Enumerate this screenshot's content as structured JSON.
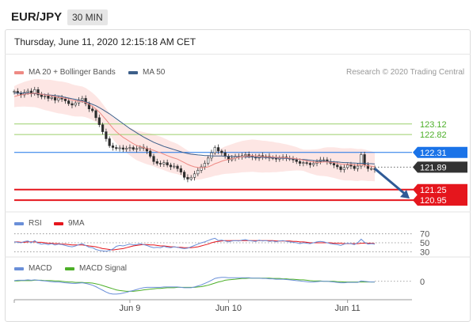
{
  "header": {
    "pair": "EUR/JPY",
    "timeframe": "30 MIN"
  },
  "datetime": "Thursday, June 11, 2020 12:15:18 AM CET",
  "credit": "Research © 2020 Trading Central",
  "legends": {
    "ma20": "MA 20 + Bollinger Bands",
    "ma50": "MA 50",
    "rsi": "RSI",
    "rsi9": "9MA",
    "macd": "MACD",
    "macd_signal": "MACD Signal"
  },
  "colors": {
    "ma20": "#ee8a84",
    "ma50": "#3d5f8a",
    "band": "#fde3e1",
    "pivot": "#1a73e8",
    "resistance": "#9ccf6b",
    "support": "#e5161d",
    "last": "#333333",
    "rsi": "#6a8fd8",
    "rsi9": "#e5161d",
    "macd": "#6a8fd8",
    "macd_signal": "#4caf28"
  },
  "chart_data": [
    {
      "type": "candlestick",
      "x_ticks": [
        "Jun 9",
        "Jun 10",
        "Jun 11"
      ],
      "price_labels": [
        {
          "label": "123.12",
          "value": 123.12,
          "kind": "resistance"
        },
        {
          "label": "122.82",
          "value": 122.82,
          "kind": "resistance"
        },
        {
          "label": "122.31",
          "value": 122.31,
          "kind": "pivot"
        },
        {
          "label": "121.89",
          "value": 121.89,
          "kind": "last"
        },
        {
          "label": "121.25",
          "value": 121.25,
          "kind": "support"
        },
        {
          "label": "120.95",
          "value": 120.95,
          "kind": "support"
        }
      ],
      "ylim": [
        120.75,
        124.4
      ],
      "close": [
        124.05,
        124.0,
        123.95,
        124.02,
        124.06,
        123.98,
        124.1,
        123.95,
        123.9,
        123.92,
        123.85,
        123.88,
        123.8,
        123.86,
        123.83,
        123.78,
        123.7,
        123.66,
        123.72,
        123.8,
        123.85,
        123.7,
        123.55,
        123.5,
        123.3,
        123.1,
        122.9,
        122.7,
        122.5,
        122.45,
        122.42,
        122.44,
        122.4,
        122.43,
        122.45,
        122.4,
        122.42,
        122.46,
        122.43,
        122.35,
        122.2,
        122.05,
        122.0,
        121.98,
        122.02,
        121.95,
        121.9,
        121.92,
        121.85,
        121.75,
        121.6,
        121.55,
        121.6,
        121.7,
        121.8,
        121.9,
        122.0,
        122.15,
        122.3,
        122.45,
        122.35,
        122.3,
        122.2,
        122.1,
        122.15,
        122.2,
        122.18,
        122.22,
        122.25,
        122.2,
        122.18,
        122.15,
        122.22,
        122.18,
        122.2,
        122.15,
        122.16,
        122.12,
        122.15,
        122.18,
        122.15,
        122.12,
        122.1,
        122.05,
        122.0,
        122.02,
        122.0,
        121.96,
        122.0,
        122.05,
        122.1,
        122.1,
        122.05,
        122.0,
        121.95,
        121.9,
        121.82,
        121.88,
        121.95,
        121.92,
        121.85,
        121.92,
        122.25,
        121.95,
        121.85,
        121.85,
        121.82
      ],
      "ma20": [
        123.9,
        123.93,
        123.95,
        123.97,
        123.98,
        123.99,
        124.0,
        123.99,
        123.97,
        123.95,
        123.94,
        123.92,
        123.9,
        123.88,
        123.87,
        123.85,
        123.83,
        123.8,
        123.78,
        123.77,
        123.76,
        123.73,
        123.68,
        123.62,
        123.55,
        123.46,
        123.35,
        123.24,
        123.12,
        123.0,
        122.9,
        122.82,
        122.74,
        122.68,
        122.62,
        122.56,
        122.51,
        122.48,
        122.45,
        122.42,
        122.4,
        122.37,
        122.33,
        122.3,
        122.26,
        122.22,
        122.18,
        122.15,
        122.12,
        122.07,
        122.02,
        121.97,
        121.93,
        121.9,
        121.88,
        121.87,
        121.88,
        121.9,
        121.94,
        121.99,
        122.02,
        122.06,
        122.09,
        122.11,
        122.13,
        122.15,
        122.17,
        122.19,
        122.2,
        122.21,
        122.22,
        122.21,
        122.2,
        122.19,
        122.19,
        122.18,
        122.18,
        122.17,
        122.17,
        122.16,
        122.16,
        122.15,
        122.14,
        122.13,
        122.11,
        122.09,
        122.07,
        122.05,
        122.04,
        122.03,
        122.03,
        122.04,
        122.04,
        122.03,
        122.02,
        122.0,
        121.98,
        121.97,
        121.97,
        121.97,
        121.96,
        121.95,
        121.96,
        121.95,
        121.93,
        121.92,
        121.9
      ],
      "ma50": [
        124.0,
        124.0,
        124.0,
        124.0,
        124.0,
        123.99,
        123.99,
        123.98,
        123.97,
        123.96,
        123.95,
        123.94,
        123.93,
        123.92,
        123.9,
        123.88,
        123.86,
        123.84,
        123.82,
        123.8,
        123.78,
        123.75,
        123.72,
        123.68,
        123.64,
        123.59,
        123.53,
        123.47,
        123.41,
        123.34,
        123.27,
        123.2,
        123.13,
        123.06,
        122.99,
        122.93,
        122.87,
        122.81,
        122.75,
        122.7,
        122.65,
        122.6,
        122.56,
        122.52,
        122.48,
        122.45,
        122.42,
        122.39,
        122.36,
        122.33,
        122.3,
        122.28,
        122.26,
        122.25,
        122.24,
        122.23,
        122.22,
        122.22,
        122.21,
        122.21,
        122.21,
        122.21,
        122.2,
        122.2,
        122.2,
        122.19,
        122.19,
        122.19,
        122.18,
        122.18,
        122.18,
        122.17,
        122.17,
        122.17,
        122.16,
        122.16,
        122.16,
        122.15,
        122.15,
        122.14,
        122.14,
        122.13,
        122.13,
        122.12,
        122.11,
        122.11,
        122.1,
        122.09,
        122.08,
        122.07,
        122.07,
        122.06,
        122.05,
        122.05,
        122.04,
        122.04,
        122.03,
        122.02,
        122.02,
        122.01,
        122.01,
        122.0,
        122.0,
        122.0,
        121.99,
        121.99,
        121.98
      ],
      "forecast_arrow": {
        "from": 121.85,
        "to": 120.95
      }
    },
    {
      "type": "line",
      "name": "RSI",
      "levels": [
        {
          "label": "70",
          "value": 70
        },
        {
          "label": "50",
          "value": 50
        },
        {
          "label": "30",
          "value": 30
        }
      ],
      "ylim": [
        20,
        80
      ],
      "rsi": [
        52,
        51,
        50,
        53,
        54,
        50,
        55,
        49,
        47,
        48,
        46,
        48,
        45,
        47,
        46,
        44,
        42,
        41,
        43,
        46,
        48,
        44,
        40,
        39,
        35,
        33,
        32,
        31,
        33,
        36,
        42,
        44,
        43,
        45,
        47,
        45,
        46,
        48,
        46,
        44,
        41,
        39,
        40,
        39,
        42,
        40,
        39,
        41,
        40,
        38,
        37,
        38,
        41,
        44,
        47,
        50,
        52,
        55,
        58,
        60,
        55,
        56,
        54,
        52,
        54,
        55,
        54,
        56,
        57,
        55,
        54,
        53,
        56,
        54,
        55,
        53,
        54,
        52,
        54,
        55,
        53,
        52,
        51,
        50,
        48,
        50,
        49,
        48,
        50,
        52,
        53,
        52,
        50,
        48,
        47,
        46,
        44,
        47,
        49,
        48,
        46,
        50,
        58,
        51,
        47,
        48,
        47
      ],
      "ma9": [
        52,
        52,
        51,
        51,
        52,
        52,
        52,
        51,
        51,
        50,
        49,
        49,
        48,
        48,
        47,
        47,
        46,
        45,
        45,
        45,
        45,
        44,
        43,
        42,
        41,
        39,
        37,
        36,
        35,
        34,
        35,
        36,
        37,
        39,
        41,
        43,
        44,
        45,
        46,
        46,
        45,
        45,
        44,
        43,
        43,
        42,
        41,
        41,
        40,
        40,
        39,
        39,
        39,
        40,
        41,
        43,
        45,
        47,
        50,
        52,
        53,
        54,
        55,
        55,
        55,
        55,
        55,
        55,
        55,
        55,
        55,
        55,
        55,
        55,
        55,
        55,
        55,
        54,
        54,
        54,
        54,
        54,
        53,
        53,
        52,
        52,
        51,
        50,
        50,
        50,
        50,
        50,
        50,
        50,
        49,
        49,
        49,
        48,
        48,
        48,
        48,
        48,
        49,
        49,
        49,
        49,
        48
      ]
    },
    {
      "type": "line",
      "name": "MACD",
      "levels": [
        {
          "label": "0",
          "value": 0
        }
      ],
      "ylim": [
        -0.45,
        0.35
      ],
      "macd": [
        0.02,
        0.03,
        0.03,
        0.03,
        0.04,
        0.03,
        0.04,
        0.03,
        0.02,
        0.01,
        0.0,
        -0.01,
        -0.02,
        -0.02,
        -0.03,
        -0.04,
        -0.05,
        -0.06,
        -0.06,
        -0.05,
        -0.04,
        -0.06,
        -0.08,
        -0.11,
        -0.15,
        -0.2,
        -0.25,
        -0.3,
        -0.34,
        -0.36,
        -0.36,
        -0.35,
        -0.33,
        -0.31,
        -0.28,
        -0.26,
        -0.23,
        -0.2,
        -0.18,
        -0.17,
        -0.17,
        -0.17,
        -0.17,
        -0.17,
        -0.16,
        -0.16,
        -0.16,
        -0.16,
        -0.16,
        -0.17,
        -0.18,
        -0.18,
        -0.18,
        -0.16,
        -0.13,
        -0.1,
        -0.06,
        -0.02,
        0.03,
        0.08,
        0.1,
        0.11,
        0.11,
        0.1,
        0.1,
        0.1,
        0.1,
        0.1,
        0.1,
        0.1,
        0.09,
        0.09,
        0.09,
        0.08,
        0.08,
        0.07,
        0.07,
        0.06,
        0.06,
        0.06,
        0.05,
        0.04,
        0.03,
        0.02,
        0.01,
        0.0,
        -0.01,
        -0.02,
        -0.02,
        -0.01,
        0.0,
        0.0,
        0.0,
        -0.01,
        -0.02,
        -0.03,
        -0.04,
        -0.04,
        -0.03,
        -0.03,
        -0.03,
        -0.03,
        0.01,
        0.0,
        -0.01,
        -0.02,
        -0.02
      ],
      "signal": [
        0.01,
        0.01,
        0.02,
        0.02,
        0.02,
        0.02,
        0.03,
        0.03,
        0.03,
        0.02,
        0.02,
        0.02,
        0.01,
        0.01,
        0.0,
        -0.01,
        -0.02,
        -0.02,
        -0.03,
        -0.03,
        -0.03,
        -0.04,
        -0.04,
        -0.05,
        -0.07,
        -0.09,
        -0.12,
        -0.15,
        -0.18,
        -0.21,
        -0.24,
        -0.26,
        -0.27,
        -0.28,
        -0.28,
        -0.28,
        -0.27,
        -0.26,
        -0.24,
        -0.23,
        -0.22,
        -0.21,
        -0.2,
        -0.2,
        -0.19,
        -0.18,
        -0.18,
        -0.18,
        -0.17,
        -0.17,
        -0.17,
        -0.17,
        -0.17,
        -0.17,
        -0.16,
        -0.15,
        -0.13,
        -0.11,
        -0.08,
        -0.05,
        -0.02,
        0.0,
        0.03,
        0.04,
        0.05,
        0.06,
        0.07,
        0.08,
        0.08,
        0.09,
        0.09,
        0.09,
        0.09,
        0.09,
        0.09,
        0.09,
        0.08,
        0.08,
        0.08,
        0.07,
        0.07,
        0.06,
        0.06,
        0.05,
        0.04,
        0.04,
        0.03,
        0.02,
        0.01,
        0.01,
        0.01,
        0.0,
        0.0,
        0.0,
        0.0,
        -0.01,
        -0.01,
        -0.02,
        -0.02,
        -0.02,
        -0.02,
        -0.02,
        -0.02,
        -0.02,
        -0.02,
        -0.02,
        -0.02
      ]
    }
  ]
}
